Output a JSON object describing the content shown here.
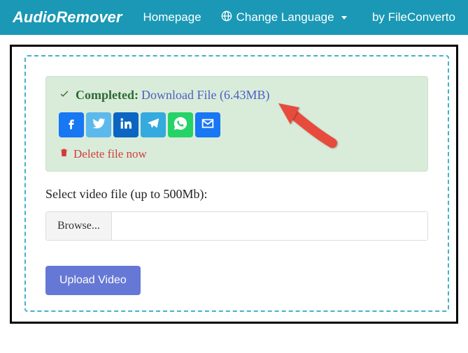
{
  "navbar": {
    "brand": "AudioRemover",
    "homepage": "Homepage",
    "change_language": "Change Language",
    "by": "by FileConverto"
  },
  "alert": {
    "completed": "Completed:",
    "download_text": "Download File (6.43MB)",
    "delete_text": "Delete file now"
  },
  "form": {
    "select_label": "Select video file (up to 500Mb):",
    "browse_label": "Browse...",
    "upload_label": "Upload Video"
  }
}
